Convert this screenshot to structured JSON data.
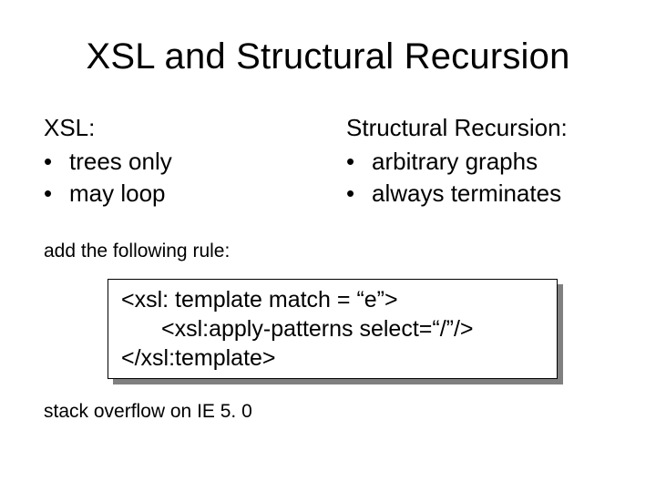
{
  "title": "XSL and Structural Recursion",
  "left": {
    "head": "XSL:",
    "items": [
      "trees only",
      "may loop"
    ]
  },
  "right": {
    "head": "Structural Recursion:",
    "items": [
      "arbitrary graphs",
      "always terminates"
    ]
  },
  "rule_intro": "add the following rule:",
  "code": {
    "l1": "<xsl: template match = “e”>",
    "l2": "<xsl:apply-patterns select=“/”/>",
    "l3": "</xsl:template>"
  },
  "footer": "stack overflow on IE 5. 0",
  "bullet": "•  "
}
